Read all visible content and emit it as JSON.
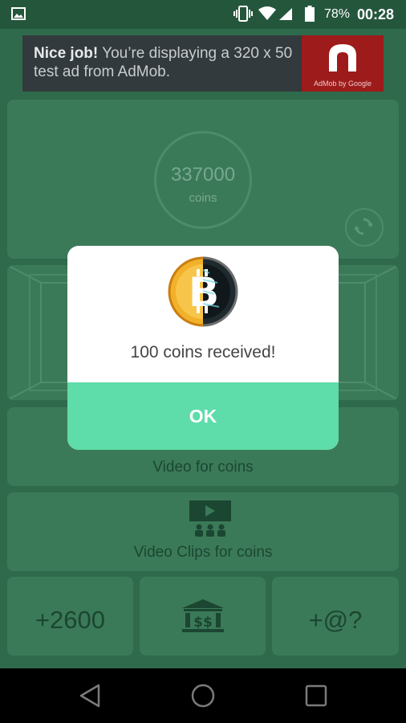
{
  "status_bar": {
    "battery_percent": "78%",
    "time": "00:28"
  },
  "ad": {
    "headline": "Nice job!",
    "body": " You’re displaying a 320 x 50 test ad from AdMob.",
    "brand": "AdMob by Google"
  },
  "balance": {
    "value": "337000",
    "unit": "coins"
  },
  "buttons": {
    "video": "Video for coins",
    "clips": "Video Clips for coins",
    "bonus": "+2600",
    "invite": "+@?"
  },
  "dialog": {
    "message": "100 coins received!",
    "ok_label": "OK"
  },
  "colors": {
    "background": "#2f6a4c",
    "panel": "#3b7a58",
    "ok_button": "#5edca9",
    "ad_brand": "#9d1b1b"
  },
  "icons": [
    "gallery-icon",
    "vibrate-icon",
    "wifi-icon",
    "signal-icon",
    "battery-icon",
    "refresh-icon",
    "video-icon",
    "bank-icon",
    "back-icon",
    "home-icon",
    "recents-icon",
    "bitcoin-icon"
  ]
}
